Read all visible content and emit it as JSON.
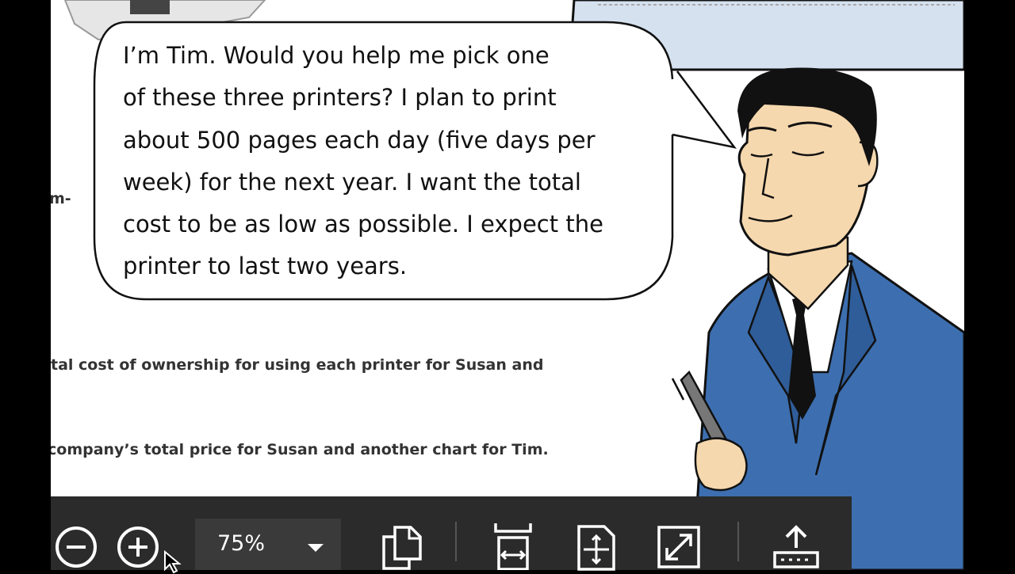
{
  "bubble": {
    "lines": [
      "I’m Tim. Would you help me pick one",
      "of these three printers?  I plan to print",
      "about 500 pages each day (five days per",
      "week) for the next year.  I want the total",
      "cost to be as low as possible. I expect the",
      "printer to last two years."
    ]
  },
  "document": {
    "fragment_1": "m-",
    "fragment_2": "",
    "line_1": "tal cost of ownership for using each printer for Susan and",
    "line_2": "company’s total price for Susan and another chart for Tim."
  },
  "toolbar": {
    "zoom_value": "75%",
    "icons": [
      "zoom-out-icon",
      "zoom-in-icon",
      "chevron-down-icon",
      "copy-icon",
      "fit-width-icon",
      "fit-page-icon",
      "fullscreen-icon",
      "share-icon"
    ]
  },
  "colors": {
    "toolbar_bg": "#2b2b2b",
    "suit_blue": "#3d6fb0",
    "skin": "#f6d8ae",
    "callout_blue": "#d5e1ef"
  }
}
